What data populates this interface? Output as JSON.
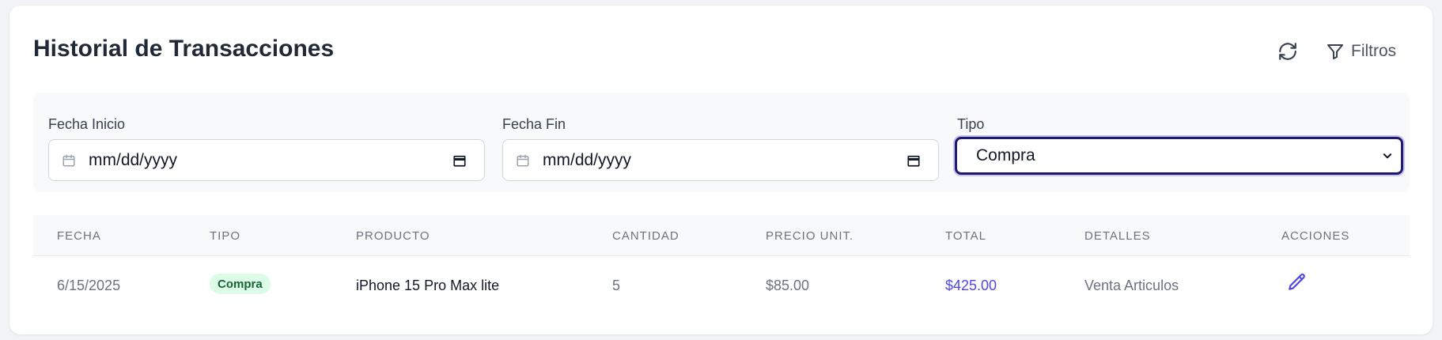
{
  "header": {
    "title": "Historial de Transacciones",
    "filters_label": "Filtros"
  },
  "filters": {
    "start_date": {
      "label": "Fecha Inicio",
      "value": "mm/dd/yyyy"
    },
    "end_date": {
      "label": "Fecha Fin",
      "value": "mm/dd/yyyy"
    },
    "type": {
      "label": "Tipo",
      "value": "Compra"
    }
  },
  "table": {
    "columns": [
      "FECHA",
      "TIPO",
      "PRODUCTO",
      "CANTIDAD",
      "PRECIO UNIT.",
      "TOTAL",
      "DETALLES",
      "ACCIONES"
    ],
    "rows": [
      {
        "date": "6/15/2025",
        "type": "Compra",
        "product": "iPhone 15 Pro Max lite",
        "quantity": "5",
        "unit_price": "$85.00",
        "total": "$425.00",
        "details": "Venta Articulos"
      }
    ]
  },
  "colors": {
    "accent": "#4f46e5",
    "badge_bg": "#dcfce7",
    "badge_text": "#166534",
    "select_border": "#1e1b6e"
  },
  "icons": [
    "refresh-icon",
    "filter-icon",
    "calendar-icon",
    "chevron-down-icon",
    "edit-icon"
  ]
}
